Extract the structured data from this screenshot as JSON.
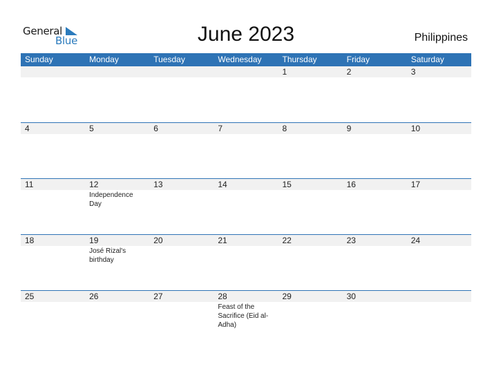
{
  "logo": {
    "word1": "General",
    "word2": "Blue"
  },
  "title": "June 2023",
  "country": "Philippines",
  "colors": {
    "accent": "#2e73b5",
    "date_row": "#f1f1f1"
  },
  "weekdays": [
    "Sunday",
    "Monday",
    "Tuesday",
    "Wednesday",
    "Thursday",
    "Friday",
    "Saturday"
  ],
  "weeks": [
    {
      "days": [
        {
          "num": "",
          "event": ""
        },
        {
          "num": "",
          "event": ""
        },
        {
          "num": "",
          "event": ""
        },
        {
          "num": "",
          "event": ""
        },
        {
          "num": "1",
          "event": ""
        },
        {
          "num": "2",
          "event": ""
        },
        {
          "num": "3",
          "event": ""
        }
      ]
    },
    {
      "days": [
        {
          "num": "4",
          "event": ""
        },
        {
          "num": "5",
          "event": ""
        },
        {
          "num": "6",
          "event": ""
        },
        {
          "num": "7",
          "event": ""
        },
        {
          "num": "8",
          "event": ""
        },
        {
          "num": "9",
          "event": ""
        },
        {
          "num": "10",
          "event": ""
        }
      ]
    },
    {
      "days": [
        {
          "num": "11",
          "event": ""
        },
        {
          "num": "12",
          "event": "Independence Day"
        },
        {
          "num": "13",
          "event": ""
        },
        {
          "num": "14",
          "event": ""
        },
        {
          "num": "15",
          "event": ""
        },
        {
          "num": "16",
          "event": ""
        },
        {
          "num": "17",
          "event": ""
        }
      ]
    },
    {
      "days": [
        {
          "num": "18",
          "event": ""
        },
        {
          "num": "19",
          "event": "José Rizal's birthday"
        },
        {
          "num": "20",
          "event": ""
        },
        {
          "num": "21",
          "event": ""
        },
        {
          "num": "22",
          "event": ""
        },
        {
          "num": "23",
          "event": ""
        },
        {
          "num": "24",
          "event": ""
        }
      ]
    },
    {
      "days": [
        {
          "num": "25",
          "event": ""
        },
        {
          "num": "26",
          "event": ""
        },
        {
          "num": "27",
          "event": ""
        },
        {
          "num": "28",
          "event": "Feast of the Sacrifice (Eid al-Adha)"
        },
        {
          "num": "29",
          "event": ""
        },
        {
          "num": "30",
          "event": ""
        },
        {
          "num": "",
          "event": ""
        }
      ]
    }
  ]
}
